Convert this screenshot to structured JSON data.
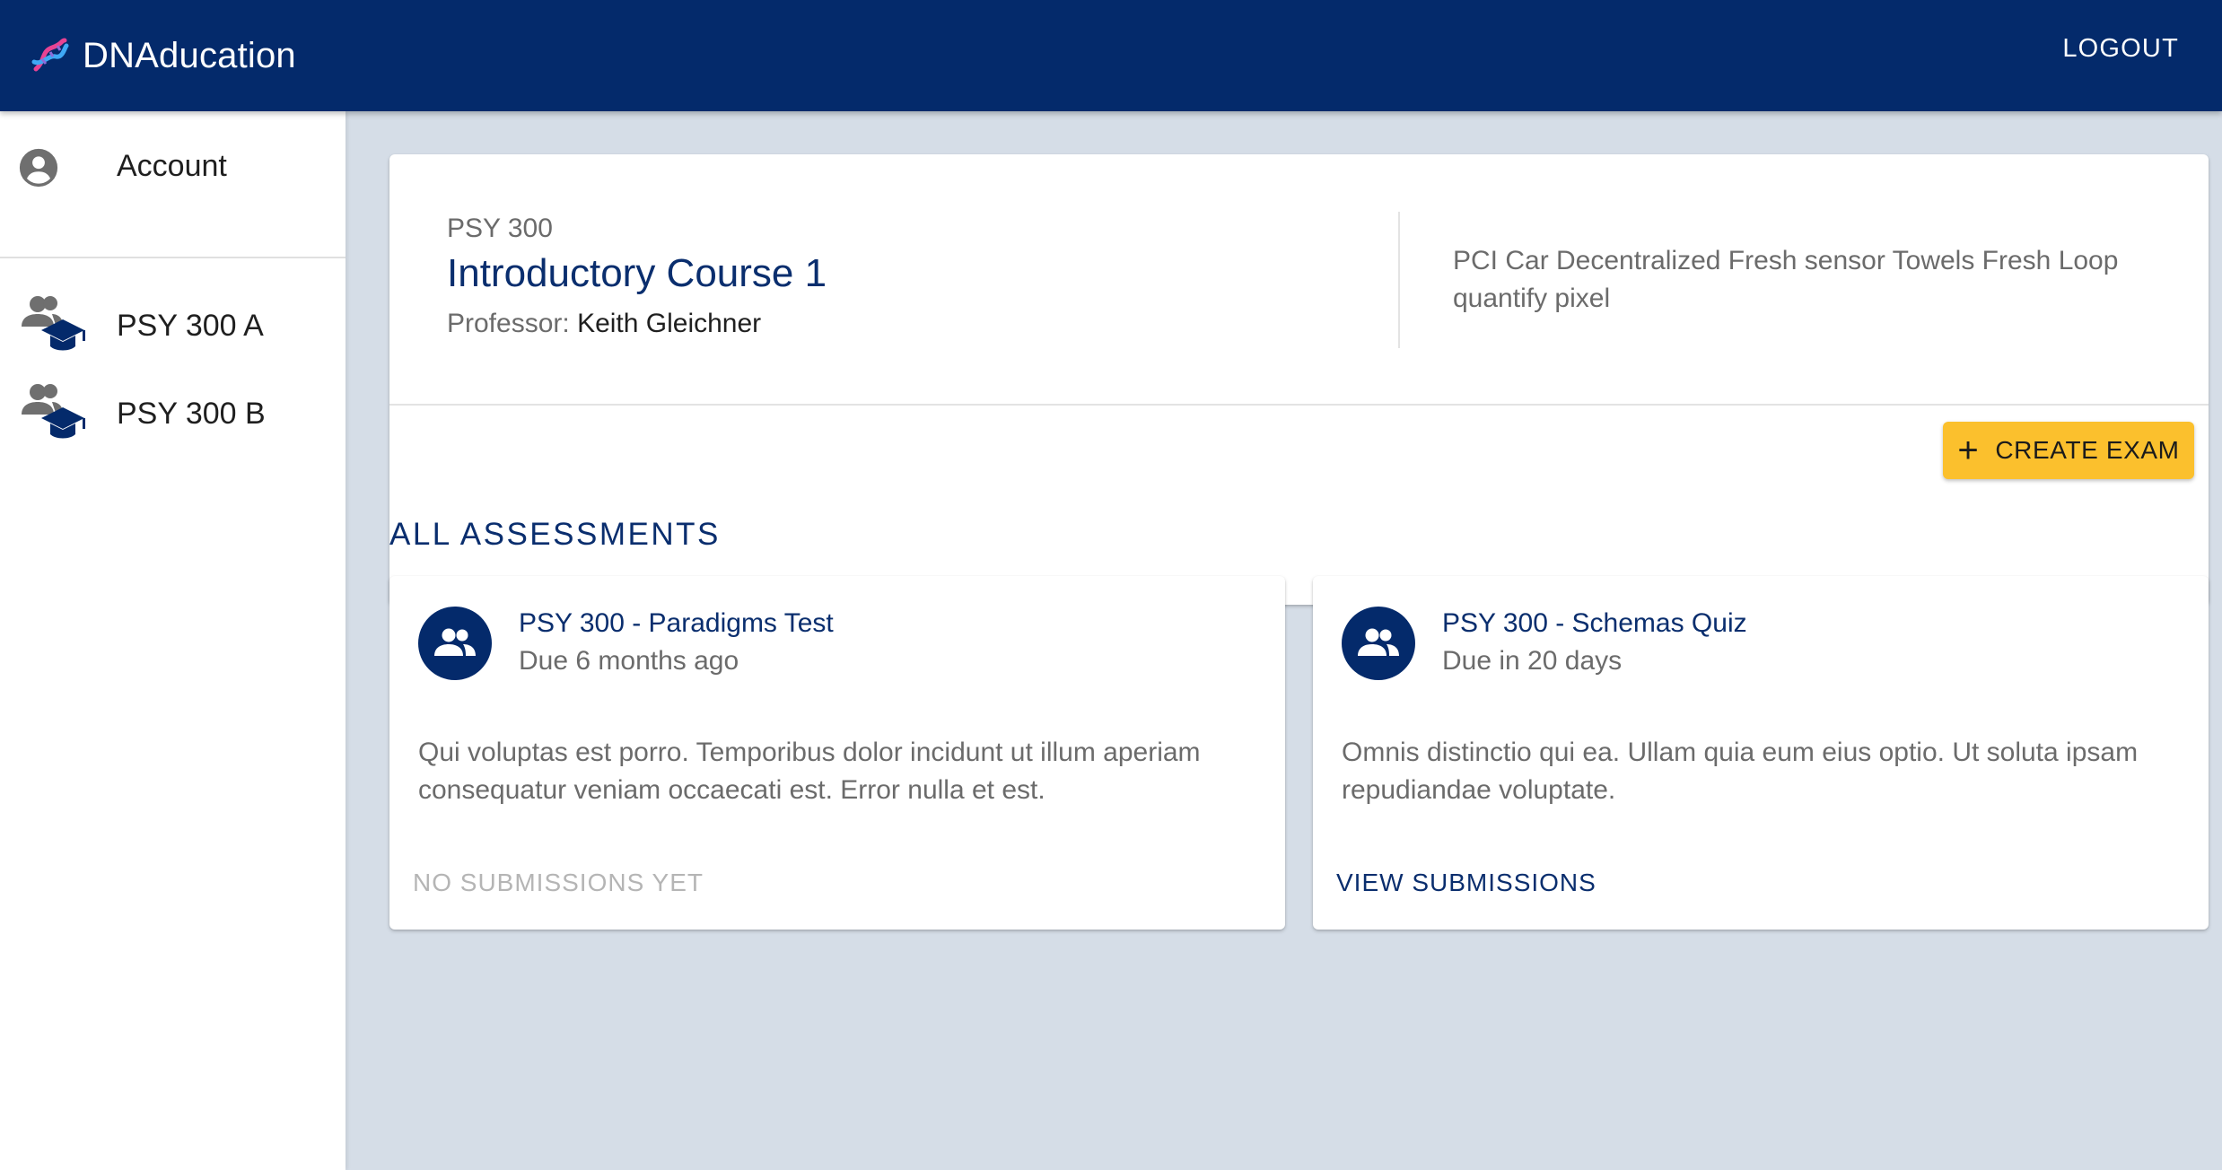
{
  "header": {
    "brand": "DNAducation",
    "logout_label": "LOGOUT"
  },
  "sidebar": {
    "items": [
      {
        "label": "Account",
        "icon": "account-circle-icon"
      },
      {
        "label": "PSY 300 A",
        "icon": "class-group-icon"
      },
      {
        "label": "PSY 300 B",
        "icon": "class-group-icon"
      }
    ]
  },
  "course": {
    "code": "PSY 300",
    "title": "Introductory Course 1",
    "professor_label": "Professor:",
    "professor_name": "Keith Gleichner",
    "description": "PCI Car Decentralized Fresh sensor Towels Fresh Loop quantify pixel",
    "create_label": "CREATE EXAM"
  },
  "assessments": {
    "section_title": "ALL ASSESSMENTS",
    "items": [
      {
        "title": "PSY 300 - Paradigms Test",
        "due": "Due 6 months ago",
        "description": "Qui voluptas est porro. Temporibus dolor incidunt ut illum aperiam consequatur veniam occaecati est. Error nulla et est.",
        "action": "NO SUBMISSIONS YET"
      },
      {
        "title": "PSY 300 - Schemas Quiz",
        "due": "Due in 20 days",
        "description": "Omnis distinctio qui ea. Ullam quia eum eius optio. Ut soluta ipsam repudiandae voluptate.",
        "action": "VIEW SUBMISSIONS"
      }
    ]
  },
  "colors": {
    "primary": "#042a6b",
    "accent": "#fbc02d",
    "background": "#d5dde7"
  }
}
